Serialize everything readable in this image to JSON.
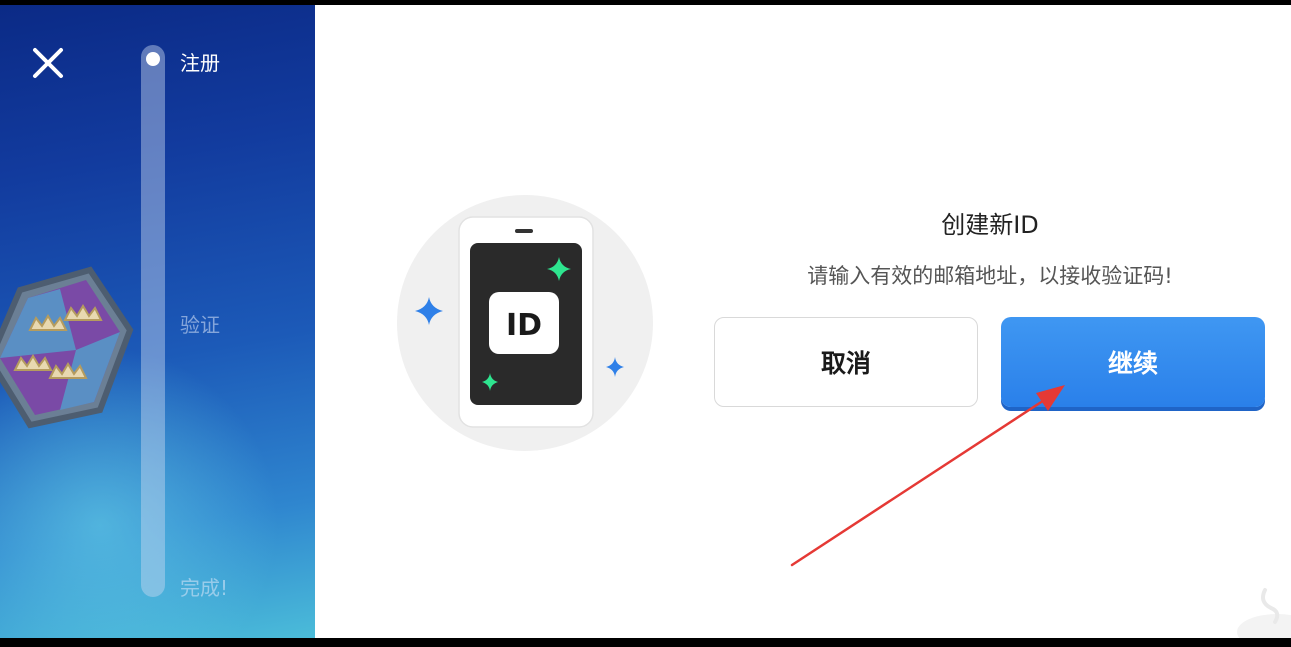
{
  "sidebar": {
    "close_icon": "close-icon",
    "steps": [
      {
        "label": "注册",
        "state": "active"
      },
      {
        "label": "验证",
        "state": "pending"
      },
      {
        "label": "完成!",
        "state": "pending"
      }
    ],
    "gradient_colors": [
      "#0b2a86",
      "#1c5ab8",
      "#4bbcd9"
    ]
  },
  "illustration": {
    "phone_icon": "phone-id-icon",
    "id_text": "ID"
  },
  "dialog": {
    "title": "创建新ID",
    "description": "请输入有效的邮箱地址，以接收验证码!",
    "cancel_label": "取消",
    "continue_label": "继续",
    "accent_color": "#2a80ea"
  },
  "annotation": {
    "arrow_color": "#e53935",
    "arrow_target": "continue-button"
  }
}
